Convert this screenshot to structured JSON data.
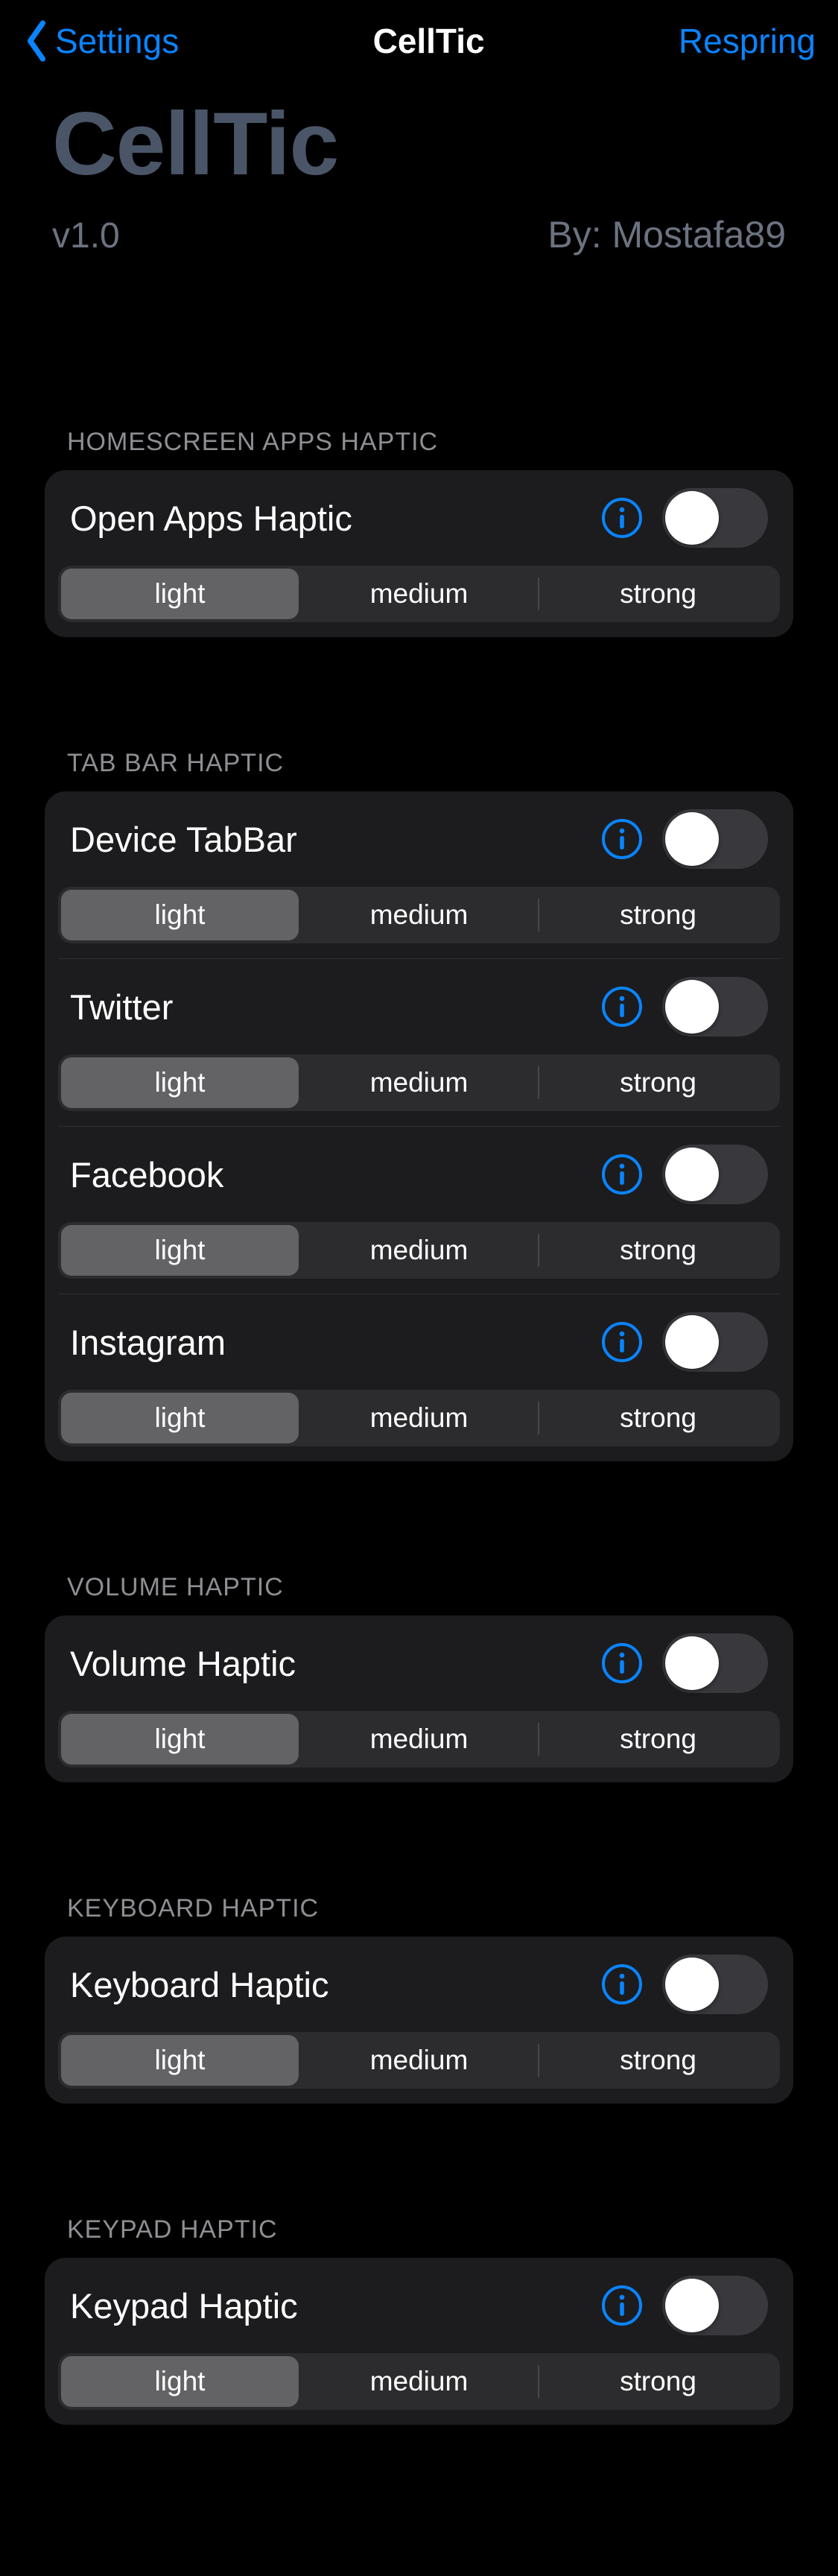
{
  "nav": {
    "back": "Settings",
    "title": "CellTic",
    "action": "Respring"
  },
  "hero": {
    "title": "CellTic",
    "version": "v1.0",
    "author": "By: Mostafa89"
  },
  "segments": [
    "light",
    "medium",
    "strong"
  ],
  "sections": [
    {
      "header": "HOMESCREEN APPS HAPTIC",
      "items": [
        {
          "label": "Open Apps Haptic",
          "on": false,
          "selected": 0
        }
      ]
    },
    {
      "header": "TAB BAR HAPTIC",
      "items": [
        {
          "label": "Device TabBar",
          "on": false,
          "selected": 0
        },
        {
          "label": "Twitter",
          "on": false,
          "selected": 0
        },
        {
          "label": "Facebook",
          "on": false,
          "selected": 0
        },
        {
          "label": "Instagram",
          "on": false,
          "selected": 0
        }
      ]
    },
    {
      "header": "VOLUME HAPTIC",
      "items": [
        {
          "label": "Volume Haptic",
          "on": false,
          "selected": 0
        }
      ]
    },
    {
      "header": "KEYBOARD HAPTIC",
      "items": [
        {
          "label": "Keyboard Haptic",
          "on": false,
          "selected": 0
        }
      ]
    },
    {
      "header": "KEYPAD HAPTIC",
      "items": [
        {
          "label": "Keypad Haptic",
          "on": false,
          "selected": 0
        }
      ]
    }
  ]
}
